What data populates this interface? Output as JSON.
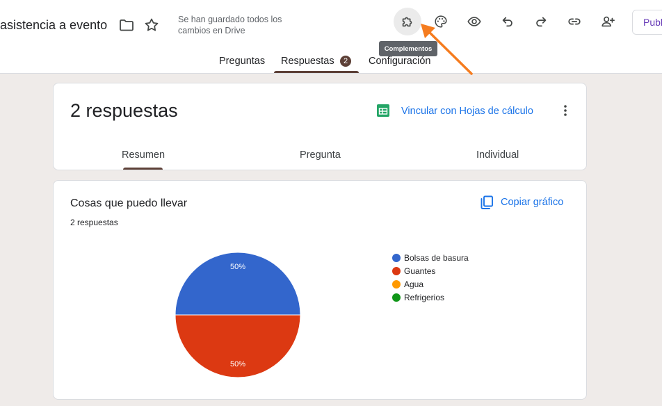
{
  "header": {
    "doc_title": "asistencia a evento",
    "save_status": "Se han guardado todos los cambios en Drive",
    "tooltip": "Complementos",
    "publish_label": "Publ",
    "icons": [
      "folder-icon",
      "star-icon",
      "addons-icon",
      "palette-icon",
      "preview-icon",
      "undo-icon",
      "redo-icon",
      "link-icon",
      "add-collaborator-icon"
    ]
  },
  "tabs": [
    {
      "label": "Preguntas"
    },
    {
      "label": "Respuestas",
      "badge": "2"
    },
    {
      "label": "Configuración"
    }
  ],
  "summary": {
    "count_label": "2 respuestas",
    "link_sheets": "Vincular con Hojas de cálculo",
    "subtabs": [
      {
        "label": "Resumen"
      },
      {
        "label": "Pregunta"
      },
      {
        "label": "Individual"
      }
    ]
  },
  "question": {
    "title": "Cosas que puedo llevar",
    "responses": "2 respuestas",
    "copy_label": "Copiar gráfico"
  },
  "chart_data": {
    "type": "pie",
    "categories": [
      "Bolsas de basura",
      "Guantes",
      "Agua",
      "Refrigerios"
    ],
    "values": [
      50,
      50,
      0,
      0
    ],
    "data_labels": [
      "50%",
      "50%"
    ],
    "colors": [
      "#3366cc",
      "#dc3912",
      "#ff9900",
      "#109618"
    ],
    "legend": "right"
  },
  "colors": {
    "accent": "#5d4037",
    "link": "#1a73e8",
    "publish": "#673ab7",
    "annotation_arrow": "#f57c1f"
  }
}
